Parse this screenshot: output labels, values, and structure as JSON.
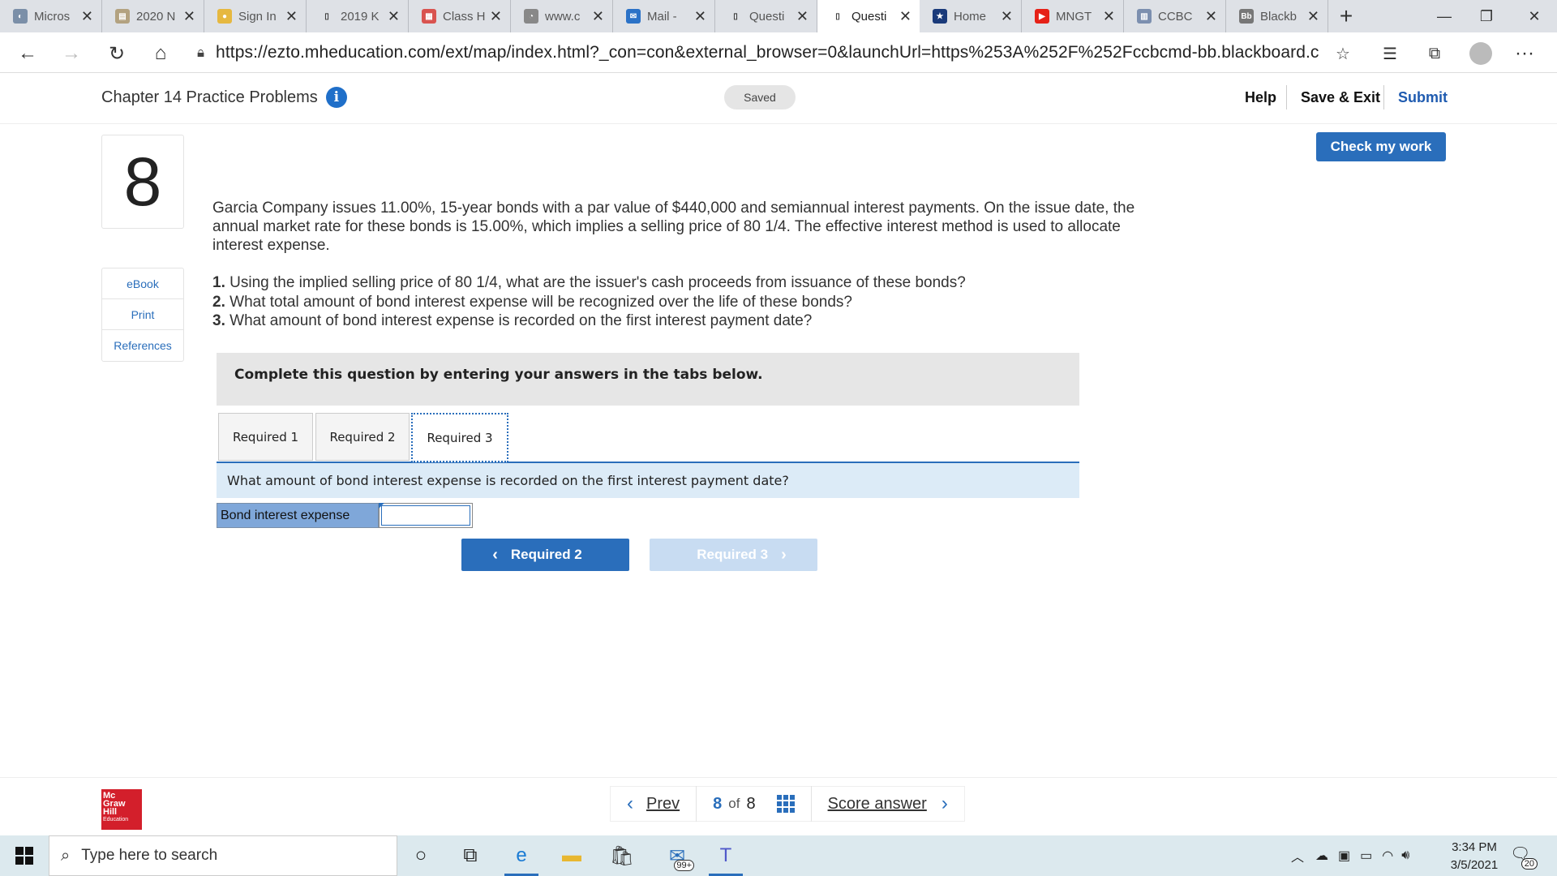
{
  "browser": {
    "tabs": [
      {
        "title": "Micros",
        "fav_color": "#7b8fa8",
        "fav_glyph": "◐"
      },
      {
        "title": "2020 N",
        "fav_color": "#b3a280",
        "fav_glyph": "▤"
      },
      {
        "title": "Sign In",
        "fav_color": "#e6b840",
        "fav_glyph": "●"
      },
      {
        "title": "2019 K",
        "fav_color": "#dee1e6",
        "fav_glyph": "▯"
      },
      {
        "title": "Class H",
        "fav_color": "#d9534f",
        "fav_glyph": "▦"
      },
      {
        "title": "www.c",
        "fav_color": "#888888",
        "fav_glyph": "◔"
      },
      {
        "title": "Mail -",
        "fav_color": "#2b72c7",
        "fav_glyph": "✉"
      },
      {
        "title": "Questi",
        "fav_color": "#dee1e6",
        "fav_glyph": "▯"
      },
      {
        "title": "Questi",
        "fav_color": "#ffffff",
        "fav_glyph": "▯"
      },
      {
        "title": "Home",
        "fav_color": "#1a3a7a",
        "fav_glyph": "★"
      },
      {
        "title": "MNGT",
        "fav_color": "#e62117",
        "fav_glyph": "▶"
      },
      {
        "title": "CCBC",
        "fav_color": "#7c8faf",
        "fav_glyph": "▥"
      },
      {
        "title": "Blackb",
        "fav_color": "#777777",
        "fav_glyph": "Bb"
      }
    ],
    "active_tab_index": 8,
    "url": "https://ezto.mheducation.com/ext/map/index.html?_con=con&external_browser=0&launchUrl=https%253A%252F%252Fccbcmd-bb.blackboard.com..."
  },
  "header": {
    "title": "Chapter 14 Practice Problems",
    "saved_label": "Saved",
    "help_label": "Help",
    "save_exit_label": "Save & Exit",
    "submit_label": "Submit"
  },
  "question": {
    "number": "8",
    "check_label": "Check my work",
    "side_links": [
      "eBook",
      "Print",
      "References"
    ],
    "text": "Garcia Company issues 11.00%, 15-year bonds with a par value of $440,000 and semiannual interest payments. On the issue date, the annual market rate for these bonds is 15.00%, which implies a selling price of 80 1/4. The effective interest method is used to allocate interest expense.",
    "items": [
      {
        "num": "1.",
        "text": " Using the implied selling price of 80 1/4, what are the issuer's cash proceeds from issuance of these bonds?"
      },
      {
        "num": "2.",
        "text": " What total amount of bond interest expense will be recognized over the life of these bonds?"
      },
      {
        "num": "3.",
        "text": " What amount of bond interest expense is recorded on the first interest payment date?"
      }
    ],
    "instruction": "Complete this question by entering your answers in the tabs below.",
    "tabs": [
      "Required 1",
      "Required 2",
      "Required 3"
    ],
    "active_tab": 2,
    "prompt": "What amount of bond interest expense is recorded on the first interest payment date?",
    "answer_label": "Bond interest expense",
    "answer_value": "",
    "prev_label": "Required 2",
    "next_label": "Required 3"
  },
  "footer": {
    "logo_lines": [
      "Mc",
      "Graw",
      "Hill",
      "Education"
    ],
    "prev_label": "Prev",
    "current": "8",
    "of_label": "of",
    "total": "8",
    "score_label": "Score answer"
  },
  "taskbar": {
    "search_placeholder": "Type here to search",
    "mail_badge": "99+",
    "time": "3:34 PM",
    "date": "3/5/2021",
    "notif_count": "20"
  }
}
